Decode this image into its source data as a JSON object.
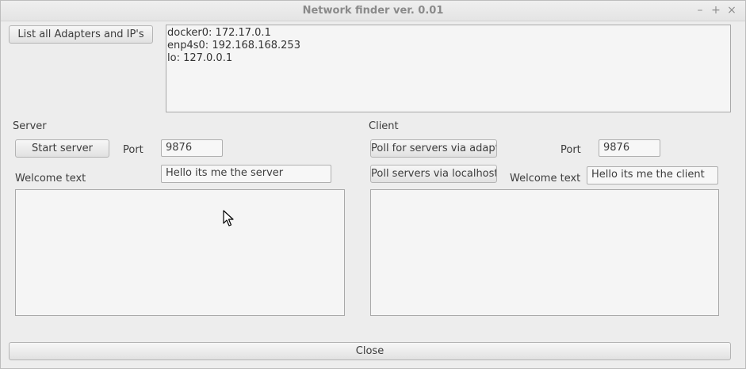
{
  "window": {
    "title": "Network finder ver. 0.01",
    "controls": {
      "minimize": "–",
      "maximize": "+",
      "close": "×"
    }
  },
  "toolbar": {
    "list_adapters_label": "List all Adapters and IP's"
  },
  "adapters": [
    "docker0: 172.17.0.1",
    "enp4s0: 192.168.168.253",
    "lo: 127.0.0.1"
  ],
  "server": {
    "heading": "Server",
    "start_label": "Start server",
    "port_label": "Port",
    "port_value": "9876",
    "welcome_label": "Welcome text",
    "welcome_value": "Hello its me the server",
    "log": ""
  },
  "client": {
    "heading": "Client",
    "poll_adapter_label": "Poll for servers via adapter",
    "poll_localhost_label": "Poll servers via localhost",
    "port_label": "Port",
    "port_value": "9876",
    "welcome_label": "Welcome text",
    "welcome_value": "Hello its me the client",
    "log": ""
  },
  "footer": {
    "close_label": "Close"
  }
}
